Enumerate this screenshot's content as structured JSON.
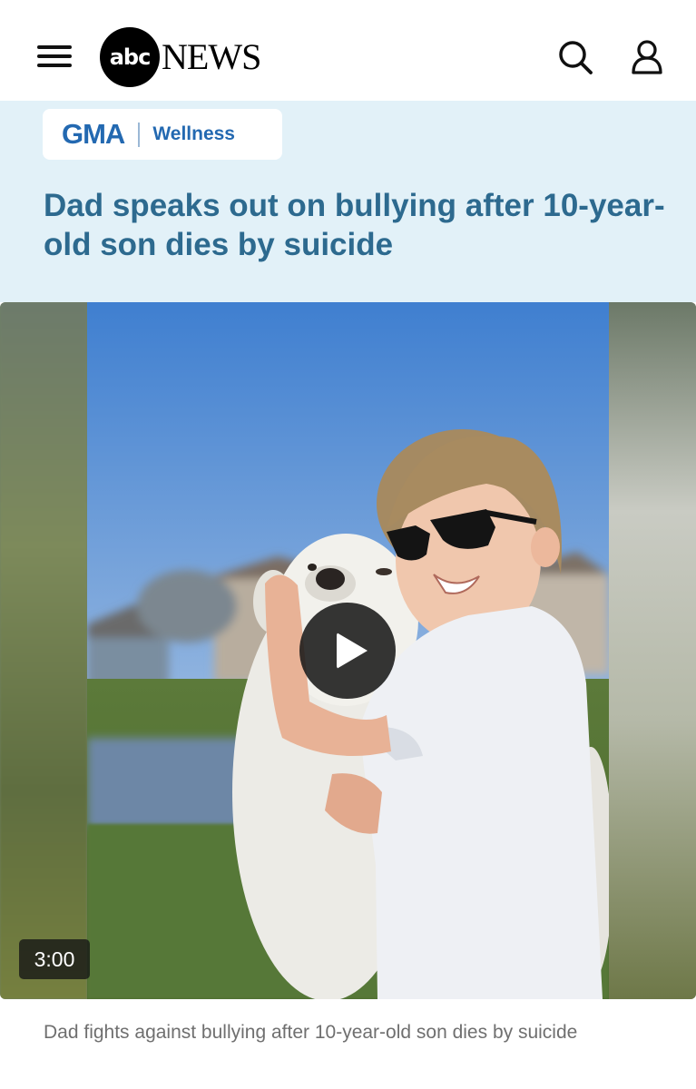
{
  "header": {
    "menu_icon": "hamburger-menu-icon",
    "logo_abc": "abc",
    "logo_news": "NEWS",
    "search_icon": "search-icon",
    "account_icon": "user-icon"
  },
  "hero": {
    "brand": "GMA",
    "section": "Wellness",
    "headline": "Dad speaks out on bullying after 10-year-old son dies by suicide",
    "background_color": "#e2f1f8",
    "accent_color": "#2369b1"
  },
  "video": {
    "play_icon": "play-icon",
    "duration": "3:00",
    "caption": "Dad fights against bullying after 10-year-old son dies by suicide"
  }
}
